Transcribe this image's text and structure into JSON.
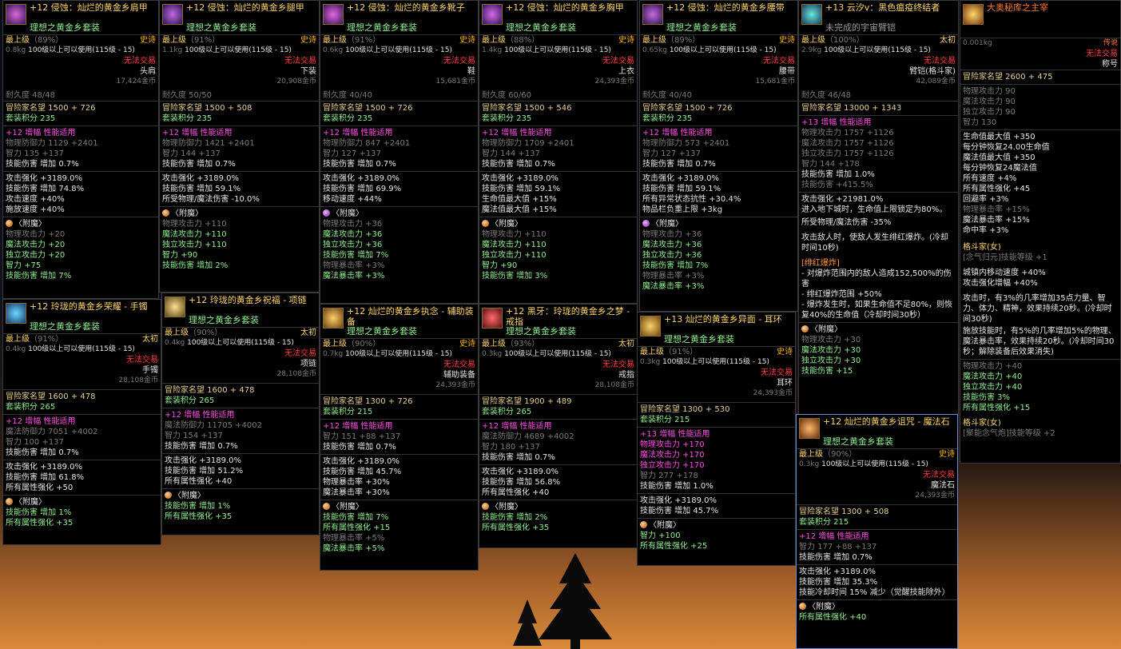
{
  "cards": [
    {
      "name": "+12 侵蚀：灿烂的黄金乡肩甲",
      "set": "理想之黄金乡套装",
      "grade": "最上级",
      "pct": "（89%）",
      "rarity": "史诗",
      "weight": "0.8kg",
      "req": "100级以上可以使用(115级 - 15)",
      "trade": "无法交易",
      "slot": "头肩",
      "price": "17,424金币",
      "durability": "耐久度 48/48",
      "fame": "冒险家名望 1500 + 726",
      "setpts": "套装积分 235",
      "amp": "+12 增幅  性能适用",
      "s1": [
        "物理防御力 1129 +2401",
        "智力 135 +137",
        "技能伤害 增加 0.7%"
      ],
      "s2": [
        "攻击强化 +3189.0%",
        "技能伤害 增加 74.8%",
        "攻击速度 +40%",
        "施放速度 +40%"
      ],
      "ench": "〈附魔〉",
      "e": [
        "物理攻击力 +20",
        "魔法攻击力 +20",
        "独立攻击力 +20",
        "智力 +75",
        "技能伤害 增加 7%"
      ]
    },
    {
      "name": "+12 侵蚀：灿烂的黄金乡腿甲",
      "set": "理想之黄金乡套装",
      "grade": "最上级",
      "pct": "（91%）",
      "rarity": "史诗",
      "weight": "1.1kg",
      "req": "100级以上可以使用(115级 - 15)",
      "trade": "无法交易",
      "slot": "下装",
      "price": "20,908金币",
      "durability": "耐久度 50/50",
      "fame": "冒险家名望 1500 + 508",
      "setpts": "套装积分 235",
      "amp": "+12 增幅  性能适用",
      "s1": [
        "物理防御力 1421 +2401",
        "智力 144 +137",
        "技能伤害 增加 0.7%"
      ],
      "s2": [
        "攻击强化 +3189.0%",
        "技能伤害 增加 59.1%",
        "所受物理/魔法伤害 -10.0%"
      ],
      "ench": "〈附魔〉",
      "e": [
        "物理攻击力 +110",
        "魔法攻击力 +110",
        "独立攻击力 +110",
        "智力 +90",
        "技能伤害 增加 2%"
      ]
    },
    {
      "name": "+12 侵蚀：灿烂的黄金乡靴子",
      "set": "理想之黄金乡套装",
      "grade": "最上级",
      "pct": "（91%）",
      "rarity": "史诗",
      "weight": "0.6kg",
      "req": "100级以上可以使用(115级 - 15)",
      "trade": "无法交易",
      "slot": "鞋",
      "price": "15,681金币",
      "durability": "耐久度 40/40",
      "fame": "冒险家名望 1500 + 726",
      "setpts": "套装积分 235",
      "amp": "+12 增幅  性能适用",
      "s1": [
        "物理防御力 847 +2401",
        "智力 127 +137",
        "技能伤害 增加 0.7%"
      ],
      "s2": [
        "攻击强化 +3189.0%",
        "技能伤害 增加 69.9%",
        "移动速度 +44%"
      ],
      "ench": "〈附魔〉",
      "e": [
        "物理攻击力 +36",
        "魔法攻击力 +36",
        "独立攻击力 +36",
        "技能伤害 增加 7%",
        "物理暴击率 +3%",
        "魔法暴击率 +3%"
      ]
    },
    {
      "name": "+12 侵蚀：灿烂的黄金乡胸甲",
      "set": "理想之黄金乡套装",
      "grade": "最上级",
      "pct": "（88%）",
      "rarity": "史诗",
      "weight": "1.4kg",
      "req": "100级以上可以使用(115级 - 15)",
      "trade": "无法交易",
      "slot": "上衣",
      "price": "24,393金币",
      "durability": "耐久度 60/60",
      "fame": "冒险家名望 1500 + 546",
      "setpts": "套装积分 235",
      "amp": "+12 增幅  性能适用",
      "s1": [
        "物理防御力 1709 +2401",
        "智力 144 +137",
        "技能伤害 增加 0.7%"
      ],
      "s2": [
        "攻击强化 +3189.0%",
        "技能伤害 增加 59.1%",
        "生命值最大值 +15%",
        "魔法值最大值 +15%"
      ],
      "ench": "〈附魔〉",
      "e": [
        "物理攻击力 +110",
        "魔法攻击力 +110",
        "独立攻击力 +110",
        "智力 +90",
        "技能伤害 增加 3%"
      ]
    },
    {
      "name": "+12 侵蚀：灿烂的黄金乡腰带",
      "set": "理想之黄金乡套装",
      "grade": "最上级",
      "pct": "（89%）",
      "rarity": "史诗",
      "weight": "0.65kg",
      "req": "100级以上可以使用(115级 - 15)",
      "trade": "无法交易",
      "slot": "腰带",
      "price": "15,681金币",
      "durability": "耐久度 40/40",
      "fame": "冒险家名望 1500 + 726",
      "setpts": "套装积分 235",
      "amp": "+12 增幅  性能适用",
      "s1": [
        "物理防御力 573 +2401",
        "智力 127 +137",
        "技能伤害 增加 0.7%"
      ],
      "s2": [
        "攻击强化 +3189.0%",
        "技能伤害 增加 59.1%",
        "所有异常状态抗性 +30.4%",
        "物品栏负重上限 +3kg"
      ],
      "ench": "〈附魔〉",
      "e": [
        "物理攻击力 +36",
        "魔法攻击力 +36",
        "独立攻击力 +36",
        "技能伤害 增加 7%",
        "物理暴击率 +3%",
        "魔法暴击率 +3%"
      ]
    },
    {
      "name": "+13 云汐v：黑色瘟疫终结者",
      "sub": "未完成的宇宙臂铠",
      "grade": "最上级",
      "pct": "（100%）",
      "rarity": "太初",
      "weight": "2.9kg",
      "req": "100级以上可以使用(115级 - 15)",
      "trade": "无法交易",
      "slot": "臂铠(格斗家)",
      "price": "42,089金币",
      "durability": "耐久度 46/48",
      "fame": "冒险家名望 13000 + 1343",
      "amp": "+13 增幅  性能适用",
      "s1": [
        "物理攻击力 1757 +1126",
        "魔法攻击力 1757 +1126",
        "独立攻击力 1757 +1126",
        "智力 144 +178",
        "技能伤害 增加 1.0%",
        "技能伤害 +415.5%"
      ],
      "s2a": "攻击强化 +21981.0%",
      "s2b": "进入地下城时，生命值上限锁定为80%。",
      "s2c": "所受物理/魔法伤害 -35%",
      "s2d": "攻击敌人时，使敌人发生绯红爆炸。(冷却时间10秒)",
      "crimson": "[绯红爆炸]",
      "cr": [
        "- 对爆炸范围内的敌人造成152,500%的伤害",
        "- 绯红爆炸范围 +50%",
        "- 爆炸发生时，如果生命值不足80%，则恢复40%的生命值（冷却时间30秒）"
      ],
      "ench": "〈附魔〉",
      "e": [
        "物理攻击力 +30",
        "魔法攻击力 +30",
        "独立攻击力 +30",
        "技能伤害 +15"
      ]
    },
    {
      "name": "大奥秘库之主宰",
      "weight": "0.001kg",
      "rarity": "传说",
      "trade": "无法交易",
      "slot": "称号",
      "fame": "冒险家名望 2600 + 475",
      "s1": [
        "物理攻击力 90",
        "魔法攻击力 90",
        "独立攻击力 90",
        "智力 130"
      ],
      "s2": [
        "生命值最大值 +350",
        "每分钟恢复24.00生命值",
        "魔法值最大值 +350",
        "每分钟恢复24魔法值",
        "所有速度 +4%",
        "所有属性强化 +45",
        "回避率 +3%",
        "物理暴击率 +15%",
        "魔法暴击率 +15%",
        "命中率 +3%"
      ],
      "job": "格斗家(女)",
      "skill": "[念气归元]技能等级 +1",
      "s3": [
        "城镇内移动速度 +40%",
        "攻击强化增幅 +40%"
      ],
      "p1": "攻击时，有3%的几率增加35点力量、智力、体力、精神，效果持续20秒。(冷却时间30秒)",
      "p2": "施放技能时，有5%的几率增加5%的物理、魔法暴击率，效果持续20秒。(冷却时间30秒；解除装备后效果消失)",
      "e": [
        "物理攻击力 +40",
        "魔法攻击力 +40",
        "独立攻击力 +40",
        "技能伤害 3%",
        "所有属性强化 +15"
      ],
      "job2": "格斗家(女)",
      "skill2": "[聚能念气炮]技能等级 +2"
    },
    {
      "name": "+12 玲珑的黄金乡荣耀 - 手镯",
      "set": "理想之黄金乡套装",
      "grade": "最上级",
      "pct": "（91%）",
      "rarity": "太初",
      "weight": "0.4kg",
      "req": "100级以上可以使用(115级 - 15)",
      "trade": "无法交易",
      "slot": "手镯",
      "price": "28,108金币",
      "fame": "冒险家名望 1600 + 478",
      "setpts": "套装积分 265",
      "amp": "+12 增幅  性能适用",
      "s1": [
        "魔法防御力 7051 +4002",
        "智力 100 +137",
        "技能伤害 增加 0.7%"
      ],
      "s2": [
        "攻击强化 +3189.0%",
        "技能伤害 增加 61.8%",
        "所有属性强化 +50"
      ],
      "ench": "〈附魔〉",
      "e": [
        "技能伤害 增加 1%",
        "所有属性强化 +35"
      ]
    },
    {
      "name": "+12 玲珑的黄金乡祝福 - 项链",
      "set": "理想之黄金乡套装",
      "grade": "最上级",
      "pct": "（90%）",
      "rarity": "太初",
      "weight": "0.4kg",
      "req": "100级以上可以使用(115级 - 15)",
      "trade": "无法交易",
      "slot": "项链",
      "price": "28,108金币",
      "fame": "冒险家名望 1600 + 478",
      "setpts": "套装积分 265",
      "amp": "+12 增幅  性能适用",
      "s1": [
        "魔法防御力 11705 +4002",
        "智力 154 +137",
        "技能伤害 增加 0.7%"
      ],
      "s2": [
        "攻击强化 +3189.0%",
        "技能伤害 增加 51.2%",
        "所有属性强化 +40"
      ],
      "ench": "〈附魔〉",
      "e": [
        "技能伤害 增加 1%",
        "所有属性强化 +35"
      ]
    },
    {
      "name": "+12 灿烂的黄金乡执念 - 辅助装备",
      "set": "理想之黄金乡套装",
      "grade": "最上级",
      "pct": "（90%）",
      "rarity": "史诗",
      "weight": "0.7kg",
      "req": "100级以上可以使用(115级 - 15)",
      "trade": "无法交易",
      "slot": "辅助装备",
      "price": "24,393金币",
      "fame": "冒险家名望 1300 + 726",
      "setpts": "套装积分 215",
      "amp": "+12 增幅  性能适用",
      "s1": [
        "智力 151 +88 +137",
        "技能伤害 增加 0.7%"
      ],
      "s2": [
        "攻击强化 +3189.0%",
        "技能伤害 增加 45.7%",
        "物理暴击率 +30%",
        "魔法暴击率 +30%"
      ],
      "ench": "〈附魔〉",
      "e": [
        "技能伤害 增加 7%",
        "所有属性强化 +15",
        "物理暴击率 +5%",
        "魔法暴击率 +5%"
      ]
    },
    {
      "name": "+12 黑牙：玲珑的黄金乡之梦 - 戒指",
      "set": "理想之黄金乡套装",
      "grade": "最上级",
      "pct": "（93%）",
      "rarity": "太初",
      "weight": "0.3kg",
      "req": "100级以上可以使用(115级 - 15)",
      "trade": "无法交易",
      "slot": "戒指",
      "price": "28,108金币",
      "fame": "冒险家名望 1900 + 489",
      "setpts": "套装积分 265",
      "amp": "+12 增幅  性能适用",
      "s1": [
        "魔法防御力 4689 +4002",
        "智力 180 +137",
        "技能伤害 增加 0.7%"
      ],
      "s2": [
        "攻击强化 +3189.0%",
        "技能伤害 增加 56.8%",
        "所有属性强化 +40"
      ],
      "ench": "〈附魔〉",
      "e": [
        "技能伤害 增加 2%",
        "所有属性强化 +35"
      ]
    },
    {
      "name": "+13 灿烂的黄金乡异面 - 耳环",
      "set": "理想之黄金乡套装",
      "grade": "最上级",
      "pct": "（91%）",
      "rarity": "史诗",
      "weight": "0.3kg",
      "req": "100级以上可以使用(115级 - 15)",
      "trade": "无法交易",
      "slot": "耳环",
      "price": "24,393金币",
      "fame": "冒险家名望 1300 + 530",
      "setpts": "套装积分 215",
      "amp": "+13 增幅  性能适用",
      "s1": [
        "物理攻击力 +170",
        "魔法攻击力 +170",
        "独立攻击力 +170",
        "智力 277 +178",
        "技能伤害 增加 1.0%"
      ],
      "s2": [
        "攻击强化 +3189.0%",
        "技能伤害 增加 45.7%"
      ],
      "ench": "〈附魔〉",
      "e": [
        "智力 +100",
        "所有属性强化 +25"
      ]
    },
    {
      "name": "+12 灿烂的黄金乡诅咒 - 魔法石",
      "set": "理想之黄金乡套装",
      "grade": "最上级",
      "pct": "（90%）",
      "rarity": "史诗",
      "weight": "0.3kg",
      "req": "100级以上可以使用(115级 - 15)",
      "trade": "无法交易",
      "slot": "魔法石",
      "price": "24,393金币",
      "fame": "冒险家名望 1300 + 508",
      "setpts": "套装积分 215",
      "amp": "+12 增幅  性能适用",
      "s1": [
        "智力 177 +88 +137",
        "技能伤害 增加 0.7%"
      ],
      "s2": [
        "攻击强化 +3189.0%",
        "技能伤害 增加 35.3%",
        "技能冷却时间 15% 减少（觉醒技能除外）"
      ],
      "ench": "〈附魔〉",
      "e": [
        "所有属性强化 +40"
      ]
    }
  ],
  "colors": {
    "epic": "#ffb400",
    "primal": "#ffd56a",
    "legend": "#ff7a2a",
    "set": "#8ff08f",
    "untradeable": "#ff3c3c",
    "amp": "#ff4de6"
  }
}
